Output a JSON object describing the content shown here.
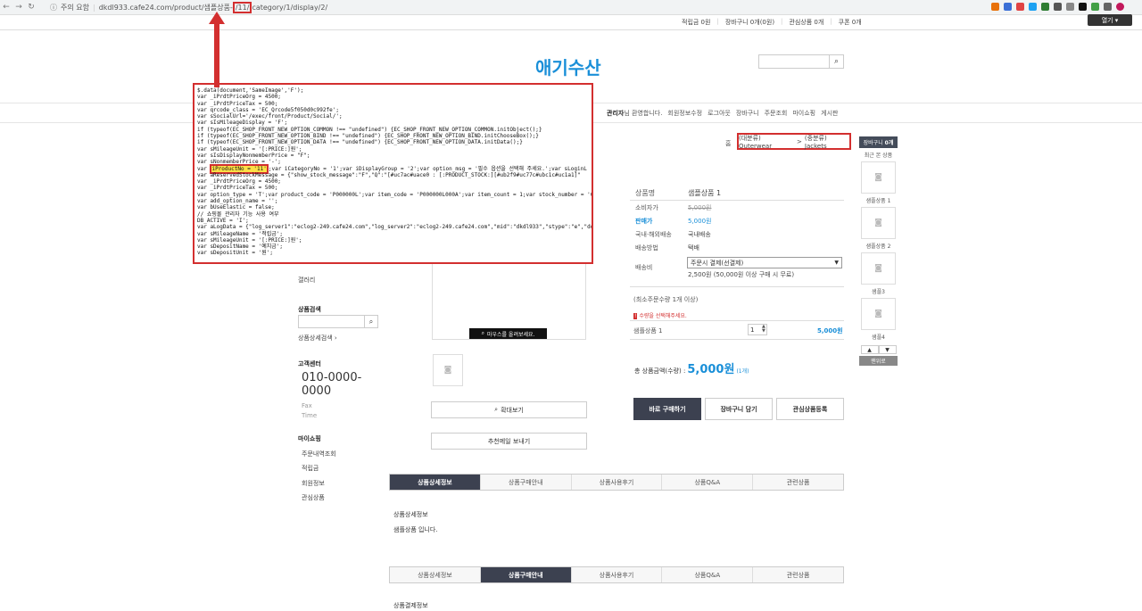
{
  "browser": {
    "warning": "주의 요함",
    "url_prefix": "dkdl933.cafe24.com/product/샘플상품-",
    "url_highlight": "/11/",
    "url_suffix": "category/1/display/2/"
  },
  "util": {
    "points": "적립금 0원",
    "cart": "장바구니 0개(0원)",
    "wish": "관심상품 0개",
    "coupon": "쿠폰 0개",
    "open_label": "열기 ▾"
  },
  "logo": "애기수산",
  "member_nav": {
    "greeting_bold": "관리자",
    "greeting": "님 환영합니다.",
    "items": [
      "회원정보수정",
      "로그아웃",
      "장바구니",
      "주문조회",
      "마이쇼핑",
      "게시판"
    ]
  },
  "code_lines": [
    "$.data(document,'SameImage','F');",
    "var _iPrdtPriceOrg = 4500;",
    "var _iPrdtPriceTax = 500;",
    "var qrcode_class = 'EC_Qrcode5f050d0c992fe';",
    "var sSocialUrl='/exec/front/Product/Social/';",
    "var sIsMileageDisplay = 'F';",
    "if (typeof(EC_SHOP_FRONT_NEW_OPTION_COMMON !== \"undefined\") {EC_SHOP_FRONT_NEW_OPTION_COMMON.initObject();}",
    "if (typeof(EC_SHOP_FRONT_NEW_OPTION_BIND !== \"undefined\") {EC_SHOP_FRONT_NEW_OPTION_BIND.initChooseBox();}",
    "if (typeof(EC_SHOP_FRONT_NEW_OPTION_DATA !== \"undefined\") {EC_SHOP_FRONT_NEW_OPTION_DATA.initData();}",
    "var sMileageUnit = '[:PRICE:]원';",
    "var sIsDisplayNonmemberPrice = \"F\";",
    "var sNonmemberPrice = '-';",
    "var ",
    "var aReservedStockMessage = {\"show_stock_message\":\"F\",\"Q\":\"[#uc7ac#uace0 : [:PRODUCT_STOCK:][#ub2f9#uc77c#ubc1c#uc1a1]\"",
    "var _iPrdtPriceOrg = 4500;",
    "var _iPrdtPriceTax = 500;",
    "var option_type = 'T';var product_code = 'P000000L';var item_code = 'P000000L000A';var item_count = 1;var stock_number = 'C",
    "var add_option_name = '';",
    "var bUseElastic = false;",
    "// 쇼핑몰 관리자 기능 사용 여부",
    "DB_ACTIVE = 'I';",
    "var aLogData = {\"log_server1\":\"eclog2-249.cafe24.com\",\"log_server2\":\"eclog2-249.cafe24.com\",\"mid\":\"dkdl933\",\"stype\":\"e\",\"doma",
    "var sMileageName = '적립금';",
    "var sMileageUnit = '[:PRICE:]원';",
    "var sDepositName = '예치금';",
    "var sDepositUnit = '원';"
  ],
  "code_hl_line": {
    "highlight": "iProductNo = '11'",
    "rest": ";var iCategoryNo = '1';var iDisplayGroup = '2';var option_msg = '필수 옵션을 선택해 주세요.';var sLoginL"
  },
  "breadcrumb": {
    "home": "홈",
    "cat1": "(대분류) Outerwear",
    "sep": ">",
    "cat2": "(중분류) Jackets"
  },
  "quick": {
    "head": "장바구니",
    "count": "0개",
    "recent": "최근 본 상품",
    "thumbs": [
      "샘플상품 1",
      "샘플상품 2",
      "샘플3",
      "샘플4"
    ],
    "up": "▲",
    "down": "▼",
    "top": "맨위로"
  },
  "sidebar": {
    "gallery_label": "갤러리",
    "search_title": "상품검색",
    "detail_search": "상품상세검색 ›",
    "cs_title": "고객센터",
    "phone": "010-0000-0000",
    "fax": "Fax",
    "time": "Time",
    "myshop_title": "마이쇼핑",
    "myshop_items": [
      "주문내역조회",
      "적립금",
      "회원정보",
      "관심상품"
    ]
  },
  "image_area": {
    "zoom_tip": "마우스를 올려보세요.",
    "zoom_btn": "확대보기",
    "recommend_btn": "추천메일 보내기"
  },
  "product": {
    "name_label": "상품명",
    "name": "샘플상품 1",
    "consumer_label": "소비자가",
    "consumer_price": "5,000원",
    "sale_label": "판매가",
    "sale_price": "5,000원",
    "origin_label": "국내·해외배송",
    "origin": "국내배송",
    "ship_method_label": "배송방법",
    "ship_method": "택배",
    "ship_fee_label": "배송비",
    "ship_select": "주문시 결제(선결제)",
    "ship_fee_note": "2,500원 (50,000원 이상 구매 시 무료)",
    "min_order": "(최소주문수량 1개 이상)",
    "option_warn": "수량을 선택해주세요.",
    "row_name": "샘플상품 1",
    "row_qty": "1",
    "row_price": "5,000원",
    "total_label": "총 상품금액(수량) : ",
    "total_price": "5,000원",
    "total_count": "(1개)",
    "buy_now": "바로 구매하기",
    "add_cart": "장바구니 담기",
    "add_wish": "관심상품등록"
  },
  "tabs": [
    "상품상세정보",
    "상품구매안내",
    "상품사용후기",
    "상품Q&A",
    "관련상품"
  ],
  "detail": {
    "section1_title": "상품상세정보",
    "section1_text": "샘플상품 입니다.",
    "section2_title": "상품결제정보"
  }
}
